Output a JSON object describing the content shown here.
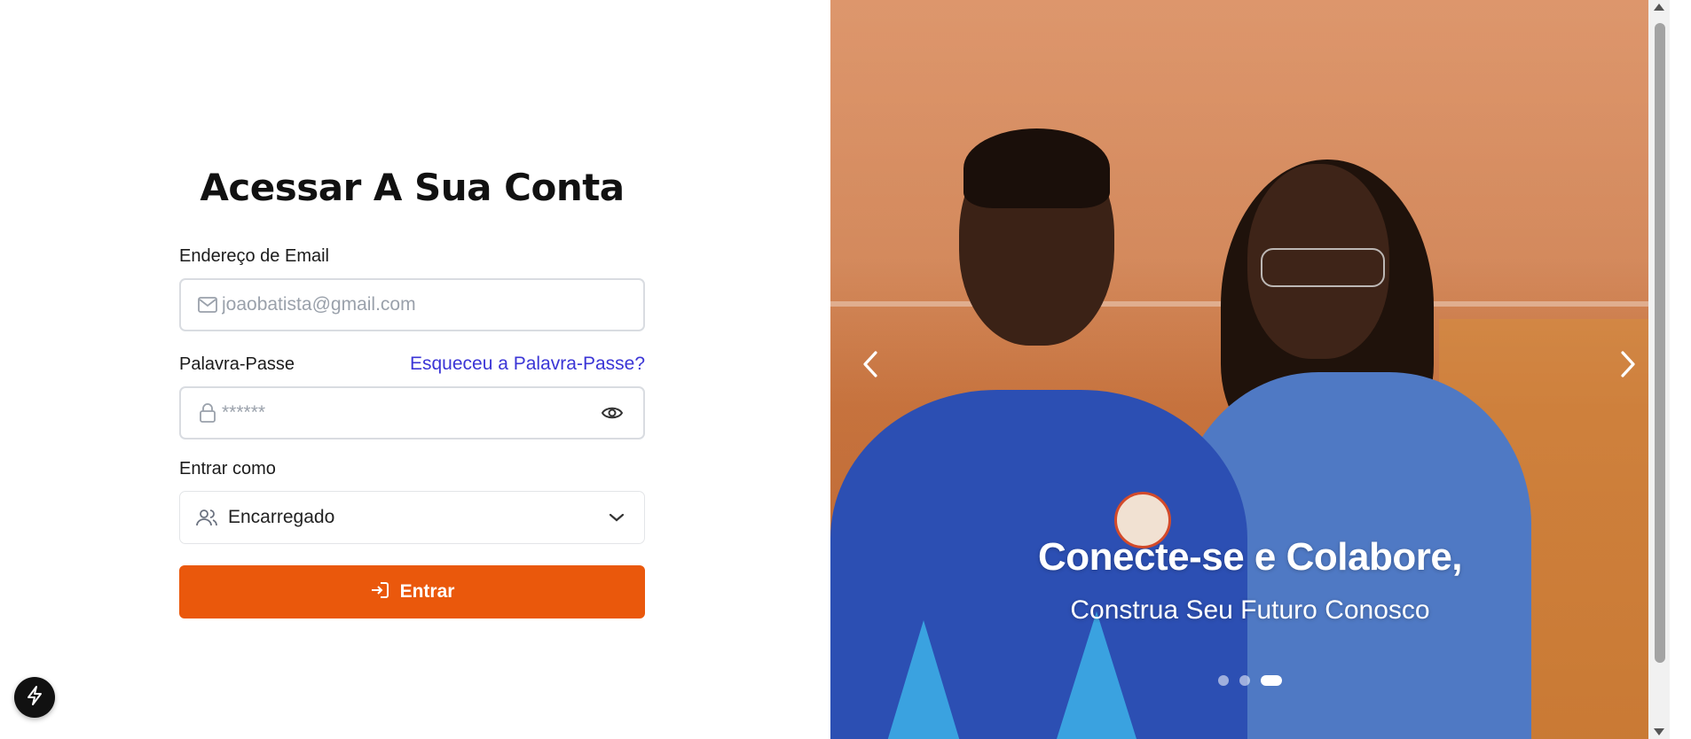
{
  "login": {
    "title": "Acessar A Sua Conta",
    "email_label": "Endereço de Email",
    "email_placeholder": "joaobatista@gmail.com",
    "password_label": "Palavra-Passe",
    "forgot_link": "Esqueceu a Palavra-Passe?",
    "password_placeholder": "******",
    "role_label": "Entrar como",
    "role_value": "Encarregado",
    "submit_label": "Entrar"
  },
  "carousel": {
    "title": "Conecte-se e Colabore,",
    "subtitle": "Construa Seu Futuro Conosco",
    "slide_count": 3,
    "active_slide": 3
  },
  "colors": {
    "accent": "#ea580c",
    "link": "#3b35d6"
  },
  "icons": [
    "mail-icon",
    "lock-icon",
    "eye-icon",
    "users-icon",
    "chevron-down-icon",
    "login-icon",
    "chevron-left-icon",
    "chevron-right-icon",
    "bolt-icon"
  ]
}
